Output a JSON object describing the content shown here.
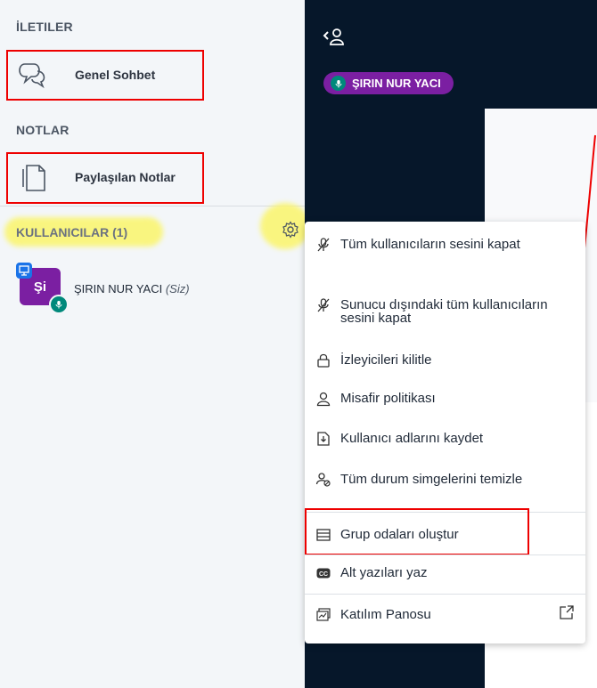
{
  "sidebar": {
    "messages_title": "İLETILER",
    "public_chat": "Genel Sohbet",
    "notes_title": "NOTLAR",
    "shared_notes": "Paylaşılan Notlar",
    "users_title": "KULLANICILAR (1)",
    "user": {
      "initials": "Şi",
      "name": "ŞIRIN NUR YACI",
      "me_label": "(Siz)"
    }
  },
  "presenter_pill": {
    "name": "ŞIRIN NUR YACI"
  },
  "menu": {
    "items": [
      {
        "icon": "mic-off-icon",
        "label": "Tüm kullanıcıların sesini kapat"
      },
      {
        "icon": "mic-off-icon",
        "label": "Sunucu dışındaki tüm kullanıcıların sesini kapat"
      },
      {
        "icon": "lock-icon",
        "label": "İzleyicileri kilitle"
      },
      {
        "icon": "user-icon",
        "label": "Misafir politikası"
      },
      {
        "icon": "download-icon",
        "label": "Kullanıcı adlarını kaydet"
      },
      {
        "icon": "clear-status-icon",
        "label": "Tüm durum simgelerini temizle"
      },
      {
        "icon": "breakout-rooms-icon",
        "label": "Grup odaları oluştur"
      },
      {
        "icon": "closed-caption-icon",
        "label": "Alt yazıları yaz"
      },
      {
        "icon": "learning-dashboard-icon",
        "label": "Katılım Panosu"
      }
    ]
  },
  "colors": {
    "accent": "#7b1fa2",
    "mic": "#00897b",
    "highlight": "#e00000",
    "dark_bg": "#06172a"
  }
}
